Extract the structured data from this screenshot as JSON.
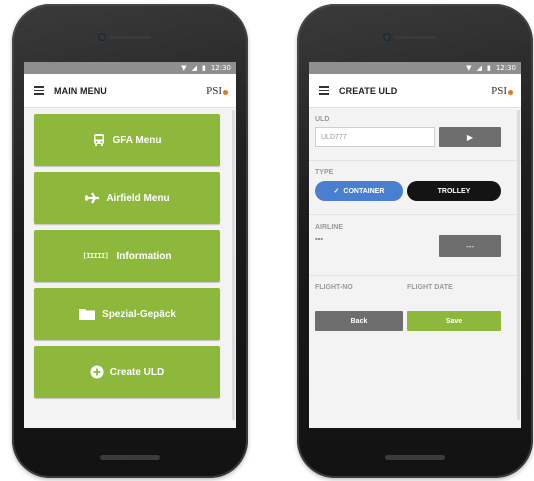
{
  "status_bar": {
    "time": "12:30"
  },
  "logo_text": "PSI",
  "main_menu": {
    "title": "MAIN MENU",
    "items": [
      {
        "label": "GFA Menu",
        "icon": "bus-icon"
      },
      {
        "label": "Airfield Menu",
        "icon": "airplane-icon"
      },
      {
        "label": "Information",
        "icon": "barcode-icon",
        "icon_text": "[IIIII]"
      },
      {
        "label": "Spezial-Gepäck",
        "icon": "folder-icon"
      },
      {
        "label": "Create ULD",
        "icon": "plus-circle-icon"
      }
    ]
  },
  "create_uld": {
    "title": "CREATE ULD",
    "uld_label": "ULD",
    "uld_value": "ULD777",
    "type_label": "TYPE",
    "type_options": [
      {
        "label": "CONTAINER",
        "selected": true
      },
      {
        "label": "TROLLEY",
        "selected": false
      }
    ],
    "airline_label": "AIRLINE",
    "airline_value": "---",
    "airline_button": "---",
    "flight_no_label": "FLIGHT-NO",
    "flight_date_label": "FLIGHT DATE",
    "back_label": "Back",
    "save_label": "Save"
  },
  "colors": {
    "accent_green": "#8db83b",
    "container_blue": "#4a7fd0",
    "trolley_black": "#141414",
    "button_grey": "#6e6e6e",
    "logo_dot": "#e07a1f"
  }
}
